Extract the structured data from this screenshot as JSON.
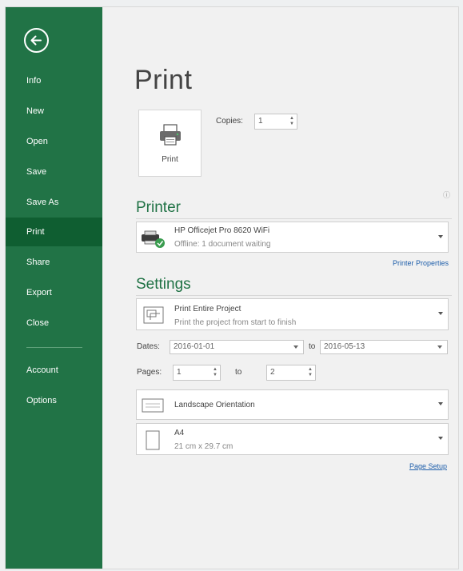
{
  "sidebar": {
    "items": [
      {
        "label": "Info"
      },
      {
        "label": "New"
      },
      {
        "label": "Open"
      },
      {
        "label": "Save"
      },
      {
        "label": "Save As"
      },
      {
        "label": "Print"
      },
      {
        "label": "Share"
      },
      {
        "label": "Export"
      },
      {
        "label": "Close"
      },
      {
        "label": "Account"
      },
      {
        "label": "Options"
      }
    ],
    "active": "Print"
  },
  "page": {
    "title": "Print",
    "print_button_label": "Print",
    "copies_label": "Copies:",
    "copies_value": "1"
  },
  "printer": {
    "heading": "Printer",
    "name": "HP Officejet Pro 8620 WiFi",
    "status": "Offline: 1 document waiting",
    "properties_link": "Printer Properties"
  },
  "settings": {
    "heading": "Settings",
    "range_title": "Print Entire Project",
    "range_desc": "Print the project from start to finish",
    "dates_label": "Dates:",
    "date_from": "2016-01-01",
    "to_label": "to",
    "date_to": "2016-05-13",
    "pages_label": "Pages:",
    "page_from": "1",
    "page_to_label": "to",
    "page_to": "2",
    "orientation": "Landscape Orientation",
    "paper_size": "A4",
    "paper_dims": "21 cm x 29.7 cm",
    "page_setup_link": "Page Setup"
  },
  "colors": {
    "sidebar": "#217346",
    "sidebar_active": "#0f5e31",
    "accent": "#217346",
    "link": "#1e5eaa"
  },
  "icons": {
    "back": "back-arrow-icon",
    "printer_button": "printer-icon",
    "printer_device": "printer-status-icon",
    "range": "print-range-icon",
    "orientation": "landscape-page-icon",
    "paper": "portrait-page-icon"
  }
}
